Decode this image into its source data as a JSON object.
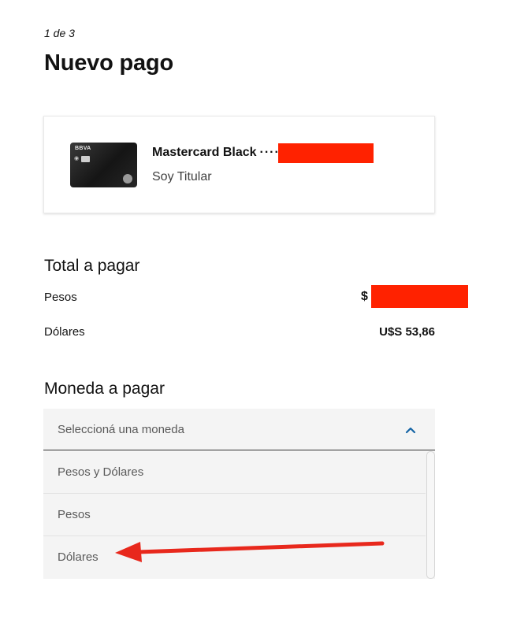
{
  "header": {
    "step": "1 de 3",
    "title": "Nuevo pago"
  },
  "card": {
    "brand": "BBVA",
    "name": "Mastercard Black",
    "masked_prefix": "····",
    "holder_type": "Soy Titular"
  },
  "total": {
    "title": "Total a pagar",
    "rows": [
      {
        "label": "Pesos",
        "value": "$"
      },
      {
        "label": "Dólares",
        "value": "U$S 53,86"
      }
    ]
  },
  "currency": {
    "title": "Moneda a pagar",
    "placeholder": "Seleccioná una moneda",
    "options": [
      "Pesos y Dólares",
      "Pesos",
      "Dólares"
    ]
  },
  "colors": {
    "redaction": "#ff2200",
    "annotation_arrow": "#e8281c",
    "chevron": "#1464a5"
  }
}
